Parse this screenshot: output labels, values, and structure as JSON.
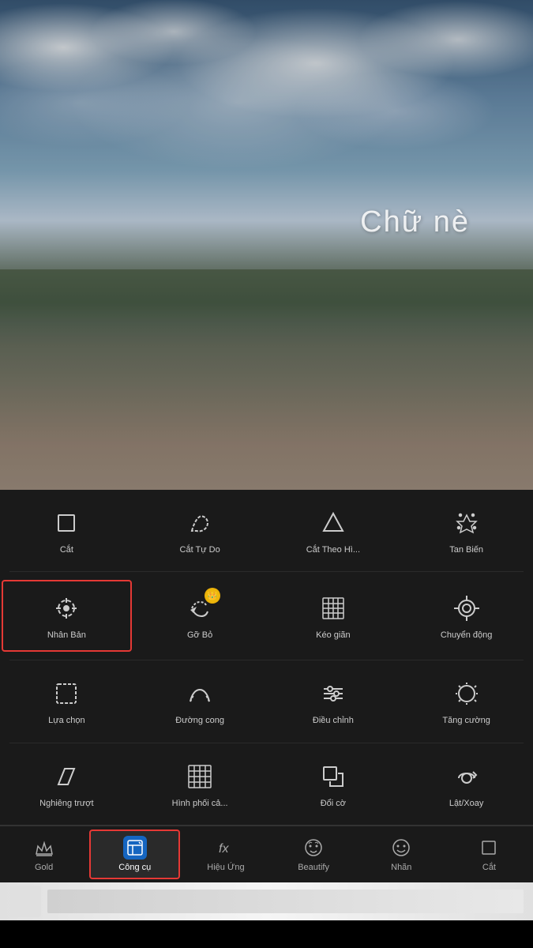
{
  "photo": {
    "overlay_text": "Chữ nè"
  },
  "tools": {
    "rows": [
      [
        {
          "id": "cat",
          "label": "Cắt",
          "icon": "crop",
          "selected": false
        },
        {
          "id": "cat-tu-do",
          "label": "Cắt Tự Do",
          "icon": "freecut",
          "selected": false
        },
        {
          "id": "cat-theo-hinh",
          "label": "Cắt Theo Hì...",
          "icon": "shapecutt",
          "selected": false
        },
        {
          "id": "tan-bien",
          "label": "Tan Biến",
          "icon": "scatter",
          "selected": false
        }
      ],
      [
        {
          "id": "nhan-ban",
          "label": "Nhân Bản",
          "icon": "clone",
          "selected": true,
          "gold": false
        },
        {
          "id": "go-bo",
          "label": "Gỡ Bỏ",
          "icon": "remove",
          "selected": false,
          "gold": true
        },
        {
          "id": "keo-gian",
          "label": "Kéo giãn",
          "icon": "stretch",
          "selected": false
        },
        {
          "id": "chuyen-dong",
          "label": "Chuyển động",
          "icon": "motion",
          "selected": false
        }
      ],
      [
        {
          "id": "lua-chon",
          "label": "Lựa chọn",
          "icon": "select",
          "selected": false
        },
        {
          "id": "duong-cong",
          "label": "Đường cong",
          "icon": "curve",
          "selected": false
        },
        {
          "id": "dieu-chinh",
          "label": "Điều chỉnh",
          "icon": "adjust",
          "selected": false
        },
        {
          "id": "tang-cuong",
          "label": "Tăng cường",
          "icon": "enhance",
          "selected": false
        }
      ],
      [
        {
          "id": "nghieng-truot",
          "label": "Nghiêng trượt",
          "icon": "tilt",
          "selected": false
        },
        {
          "id": "hinh-phoi",
          "label": "Hình phối cả...",
          "icon": "blend",
          "selected": false
        },
        {
          "id": "doi-co",
          "label": "Đổi cờ",
          "icon": "resize",
          "selected": false
        },
        {
          "id": "lat-xoay",
          "label": "Lật/Xoay",
          "icon": "fliprotate",
          "selected": false
        }
      ]
    ]
  },
  "nav": {
    "items": [
      {
        "id": "gold",
        "label": "Gold",
        "icon": "crown"
      },
      {
        "id": "cong-cu",
        "label": "Công cụ",
        "icon": "tools",
        "active": true
      },
      {
        "id": "hieu-ung",
        "label": "Hiệu Ứng",
        "icon": "effects"
      },
      {
        "id": "beautify",
        "label": "Beautify",
        "icon": "face"
      },
      {
        "id": "nhan",
        "label": "Nhãn",
        "icon": "sticker"
      },
      {
        "id": "cat-nav",
        "label": "Cắt",
        "icon": "nav-crop"
      }
    ]
  }
}
